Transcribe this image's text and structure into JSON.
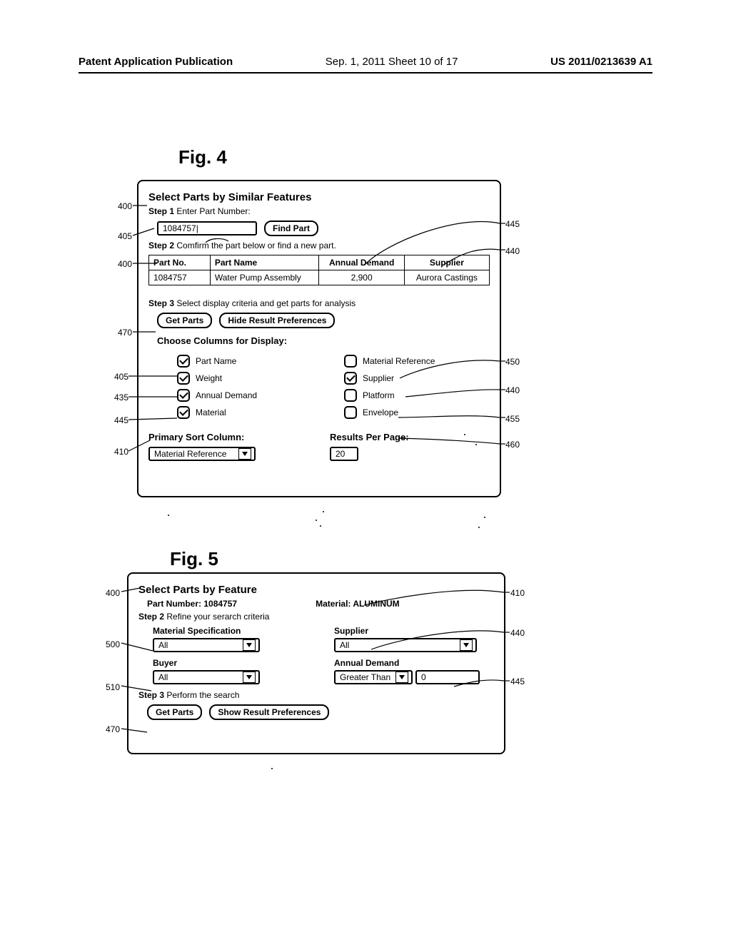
{
  "header": {
    "left": "Patent Application Publication",
    "center": "Sep. 1, 2011   Sheet 10 of 17",
    "right": "US 2011/0213639 A1"
  },
  "fig4": {
    "label": "Fig. 4",
    "title": "Select Parts by Similar Features",
    "step1_label": "Step 1",
    "step1_text": "Enter Part Number:",
    "part_input_value": "1084757|",
    "find_part_btn": "Find Part",
    "step2_label": "Step 2",
    "step2_text": "Comfirm the part below or find a new part.",
    "table": {
      "headers": [
        "Part No.",
        "Part Name",
        "Annual Demand",
        "Supplier"
      ],
      "row": [
        "1084757",
        "Water Pump Assembly",
        "2,900",
        "Aurora Castings"
      ]
    },
    "step3_label": "Step 3",
    "step3_text": "Select display criteria and get parts for analysis",
    "get_parts_btn": "Get Parts",
    "hide_prefs_btn": "Hide Result Preferences",
    "choose_cols": "Choose Columns for Display:",
    "cols_left": [
      {
        "label": "Part Name",
        "checked": true
      },
      {
        "label": "Weight",
        "checked": true
      },
      {
        "label": "Annual Demand",
        "checked": true
      },
      {
        "label": "Material",
        "checked": true
      }
    ],
    "cols_right": [
      {
        "label": "Material Reference",
        "checked": false
      },
      {
        "label": "Supplier",
        "checked": true
      },
      {
        "label": "Platform",
        "checked": false
      },
      {
        "label": "Envelope",
        "checked": false
      }
    ],
    "primary_sort_label": "Primary Sort Column:",
    "primary_sort_value": "Material Reference",
    "results_per_page_label": "Results Per Page:",
    "results_per_page_value": "20"
  },
  "fig5": {
    "label": "Fig. 5",
    "title": "Select Parts by Feature",
    "part_number_label": "Part Number:",
    "part_number_value": "1084757",
    "material_label": "Material:",
    "material_value": "ALUMINUM",
    "step2_label": "Step 2",
    "step2_text": "Refine your serarch criteria",
    "matspec_label": "Material Specification",
    "matspec_value": "All",
    "supplier_label": "Supplier",
    "supplier_value": "All",
    "buyer_label": "Buyer",
    "buyer_value": "All",
    "demand_label": "Annual Demand",
    "demand_operator": "Greater Than",
    "demand_value": "0",
    "step3_label": "Step 3",
    "step3_text": "Perform the search",
    "get_parts_btn": "Get Parts",
    "show_prefs_btn": "Show Result Preferences"
  },
  "refs": {
    "f4_400a": "400",
    "f4_405a": "405",
    "f4_400b": "400",
    "f4_445r": "445",
    "f4_440r": "440",
    "f4_470": "470",
    "f4_405b": "405",
    "f4_435": "435",
    "f4_445l": "445",
    "f4_410": "410",
    "f4_450": "450",
    "f4_440r2": "440",
    "f4_455": "455",
    "f4_460": "460",
    "f5_400": "400",
    "f5_410": "410",
    "f5_500": "500",
    "f5_440": "440",
    "f5_510": "510",
    "f5_445": "445",
    "f5_470": "470"
  }
}
